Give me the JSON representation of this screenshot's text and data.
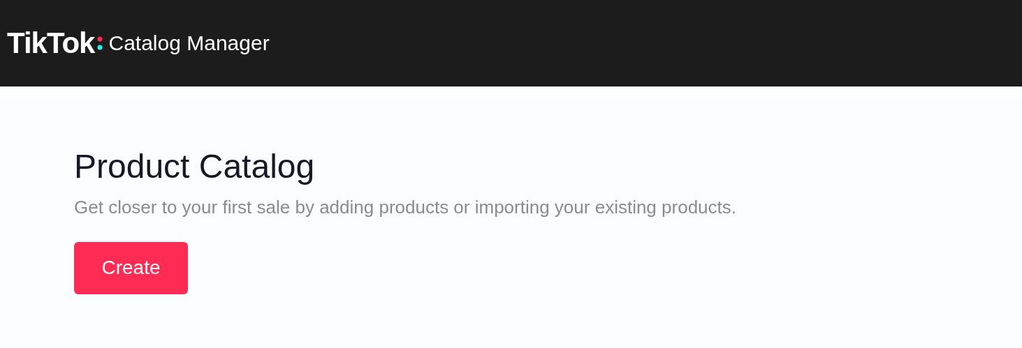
{
  "header": {
    "brand": "TikTok",
    "product": "Catalog Manager"
  },
  "page": {
    "title": "Product Catalog",
    "subtitle": "Get closer to your first sale by adding products or importing your existing products.",
    "buttons": [
      {
        "label": "Create",
        "kind": "primary"
      }
    ]
  }
}
